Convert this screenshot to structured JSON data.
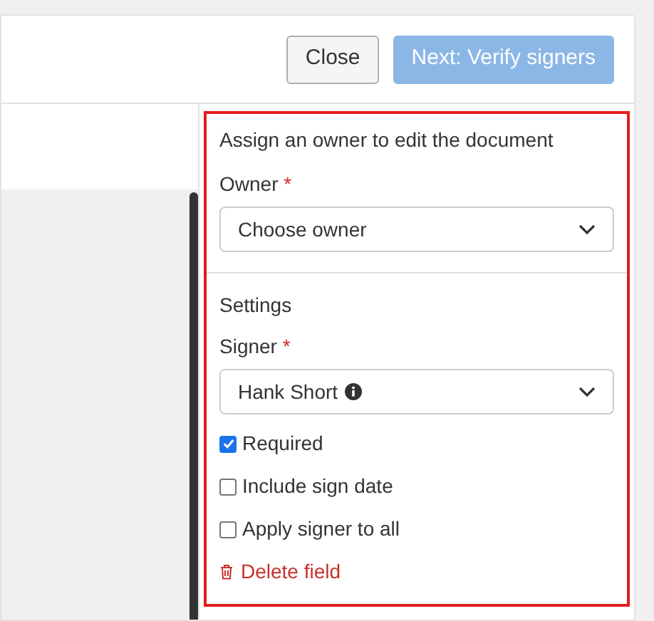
{
  "header": {
    "buttons": [
      {
        "label": "Close",
        "kind": "secondary",
        "disabled": false
      },
      {
        "label": "Next: Verify signers",
        "kind": "primary",
        "disabled": true
      }
    ]
  },
  "owner_section": {
    "heading": "Assign an owner to edit the document",
    "field": {
      "label": "Owner",
      "required_mark": "*",
      "placeholder": "Choose owner"
    }
  },
  "settings_section": {
    "heading": "Settings",
    "field": {
      "label": "Signer",
      "required_mark": "*",
      "value": "Hank Short",
      "info": true
    },
    "options": [
      {
        "label": "Required",
        "checked": true
      },
      {
        "label": "Include sign date",
        "checked": false
      },
      {
        "label": "Apply signer to all",
        "checked": false
      }
    ],
    "delete_link": "Delete field"
  }
}
